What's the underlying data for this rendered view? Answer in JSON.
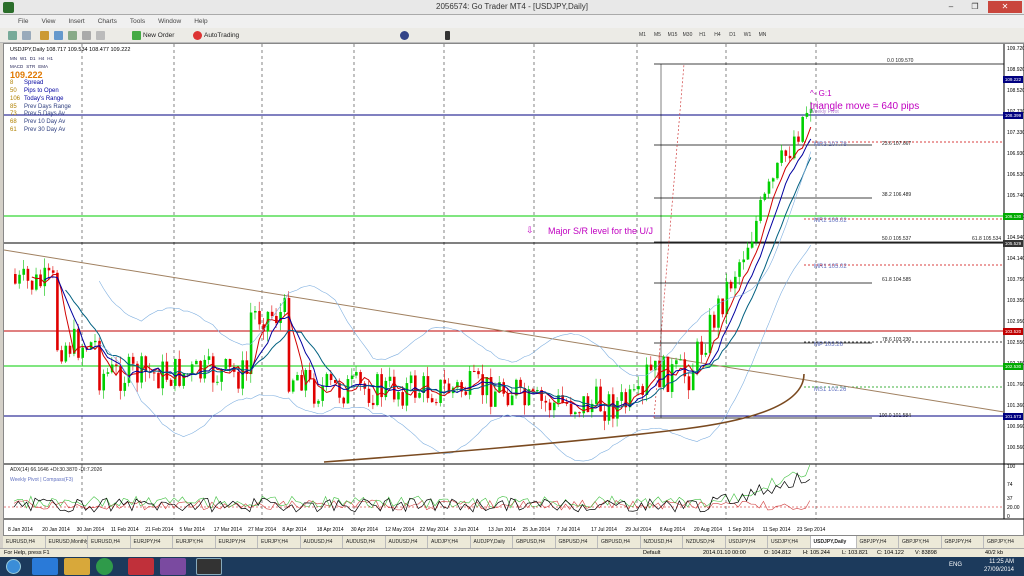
{
  "window": {
    "title": "2056574: Go Trader MT4 - [USDJPY,Daily]"
  },
  "menu": [
    "File",
    "View",
    "Insert",
    "Charts",
    "Tools",
    "Window",
    "Help"
  ],
  "toolbar": {
    "new_order": "New Order",
    "autotrading": "AutoTrading",
    "timeframes": [
      "M1",
      "M5",
      "M15",
      "M30",
      "H1",
      "H4",
      "D1",
      "W1",
      "MN"
    ]
  },
  "chart": {
    "ohlc_header": "USDJPY,Daily  108.717 109.534 108.477 109.222",
    "panel": {
      "timeframes": [
        "MN",
        "W1",
        "D1",
        "H4",
        "H1"
      ],
      "indicators": [
        "MACD",
        "STR",
        "EMA"
      ],
      "price": "109.222",
      "rows": [
        {
          "v": "8",
          "label": "Spread"
        },
        {
          "v": "50",
          "label": "Pips to Open"
        },
        {
          "v": "106",
          "label": "Today's Range"
        },
        {
          "v": "85",
          "label": "Prev Days Range"
        },
        {
          "v": "73",
          "label": "Prev 5 Days Av"
        },
        {
          "v": "68",
          "label": "Prev 10 Day Av"
        },
        {
          "v": "61",
          "label": "Prev 30 Day Av"
        }
      ]
    },
    "annotations": {
      "sr_text": "Major S/R level for the U/J",
      "arrow_glyph": "⇩",
      "triangle_text": "triangle move = 640 pips",
      "g1": "^- G:1",
      "weekly_pivot_top": "Weekly Pivot",
      "weekly_pivot_bottom": "Weekly Pivot | Compass(F3)"
    },
    "fib_labels": [
      "0.0  109.570",
      "23.6  107.667",
      "38.2  106.489",
      "50.0  105.537",
      "61.8  104.585",
      "78.6  103.230",
      "100.0  101.584"
    ],
    "fib_extra": "61.8  105.534",
    "pivots": [
      "MR3  107.78",
      "MR2  106.02",
      "MR1  105.02",
      "MP  103.26",
      "MS1  102.26"
    ],
    "price_scale": [
      "109.720",
      "108.920",
      "108.520",
      "107.730",
      "107.330",
      "106.930",
      "106.530",
      "105.740",
      "105.340",
      "104.940",
      "104.140",
      "103.750",
      "103.350",
      "102.950",
      "102.550",
      "102.150",
      "101.760",
      "101.360",
      "100.960",
      "100.560"
    ],
    "price_boxes": [
      {
        "label": "109.222",
        "color": "#000080"
      },
      {
        "label": "108.399",
        "color": "#000080"
      },
      {
        "label": "106.130",
        "color": "#00aa00"
      },
      {
        "label": "105.529",
        "color": "#333333"
      },
      {
        "label": "103.520",
        "color": "#c00000"
      },
      {
        "label": "102.530",
        "color": "#00aa00"
      },
      {
        "label": "101.573",
        "color": "#000080"
      }
    ],
    "adx_header": "ADX(14) 66.1646 +DI:30.3870 -DI:7.2026",
    "adx_scale": [
      "100",
      "74",
      "37",
      "20.00",
      "0"
    ],
    "dates": [
      "8 Jan 2014",
      "20 Jan 2014",
      "30 Jan 2014",
      "11 Feb 2014",
      "21 Feb 2014",
      "5 Mar 2014",
      "17 Mar 2014",
      "27 Mar 2014",
      "8 Apr 2014",
      "18 Apr 2014",
      "30 Apr 2014",
      "12 May 2014",
      "22 May 2014",
      "3 Jun 2014",
      "13 Jun 2014",
      "25 Jun 2014",
      "7 Jul 2014",
      "17 Jul 2014",
      "29 Jul 2014",
      "8 Aug 2014",
      "20 Aug 2014",
      "1 Sep 2014",
      "11 Sep 2014",
      "23 Sep 2014"
    ]
  },
  "tabs": [
    "EURUSD,H4",
    "EURUSD,Monthly",
    "EURUSD,H4",
    "EURJPY,H4",
    "EURJPY,H4",
    "EURJPY,H4",
    "EURJPY,H4",
    "AUDUSD,H4",
    "AUDUSD,H4",
    "AUDUSD,H4",
    "AUDJPY,H4",
    "AUDJPY,Daily",
    "GBPUSD,H4",
    "GBPUSD,H4",
    "GBPUSD,H4",
    "NZDUSD,H4",
    "NZDUSD,H4",
    "USDJPY,H4",
    "USDJPY,H4",
    "USDJPY,Daily",
    "GBPJPY,H4",
    "GBPJPY,H4",
    "GBPJPY,H4",
    "GBPJPY,H4",
    "AUDJ..."
  ],
  "active_tab_index": 19,
  "status": {
    "help": "For Help, press F1",
    "profile": "Default",
    "datetime": "2014.01.10 00:00",
    "o": "O: 104.812",
    "h": "H: 105.244",
    "l": "L: 103.821",
    "c": "C: 104.122",
    "v": "V: 83898",
    "traffic": "40/2 kb"
  },
  "taskbar": {
    "lang": "ENG",
    "time": "11:25 AM",
    "date": "27/09/2014"
  }
}
